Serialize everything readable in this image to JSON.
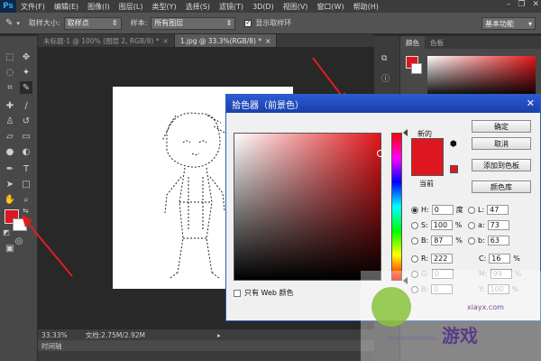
{
  "menubar": {
    "logo": "Ps",
    "items": [
      "文件(F)",
      "编辑(E)",
      "图像(I)",
      "图层(L)",
      "类型(Y)",
      "选择(S)",
      "滤镜(T)",
      "3D(D)",
      "视图(V)",
      "窗口(W)",
      "帮助(H)"
    ]
  },
  "optbar": {
    "sample_size_label": "取样大小:",
    "sample_size_value": "取样点",
    "sample_label": "样本:",
    "sample_value": "所有图层",
    "show_ring_label": "显示取样环",
    "workspace": "基本功能"
  },
  "doctabs": [
    {
      "label": "未标题-1 @ 100% (图层 2, RGB/8) *",
      "close": "×"
    },
    {
      "label": "1.jpg @ 33.3%(RGB/8) *",
      "close": "×"
    }
  ],
  "status": {
    "zoom": "33.33%",
    "doc": "文档:2.75M/2.92M"
  },
  "timeline": {
    "label": "时间轴"
  },
  "rightpanel": {
    "tabs": [
      "颜色",
      "色板"
    ]
  },
  "dialog": {
    "title": "拾色器（前景色）",
    "close": "✕",
    "new_label": "新的",
    "current_label": "当前",
    "buttons": {
      "ok": "确定",
      "cancel": "取消",
      "add_swatch": "添加到色板",
      "color_libraries": "颜色库"
    },
    "fields": {
      "H": {
        "label": "H:",
        "value": "0",
        "unit": "度"
      },
      "S": {
        "label": "S:",
        "value": "100",
        "unit": "%"
      },
      "B": {
        "label": "B:",
        "value": "87",
        "unit": "%"
      },
      "R": {
        "label": "R:",
        "value": "222"
      },
      "G": {
        "label": "G:",
        "value": "0"
      },
      "Bl": {
        "label": "B:",
        "value": "0"
      },
      "L": {
        "label": "L:",
        "value": "47"
      },
      "a": {
        "label": "a:",
        "value": "73"
      },
      "b": {
        "label": "b:",
        "value": "63"
      },
      "C": {
        "label": "C:",
        "value": "16",
        "unit": "%"
      },
      "M": {
        "label": "M:",
        "value": "99",
        "unit": "%"
      },
      "Y": {
        "label": "Y:",
        "value": "100",
        "unit": "%"
      },
      "hex": {
        "label": "#",
        "value": ""
      }
    },
    "web_only": "只有 Web 颜色"
  },
  "colors": {
    "foreground": "#de161f",
    "dialog_title_bar": "#2b5bd6",
    "selected_color": "#de161f"
  },
  "watermark": {
    "text": "游戏",
    "url": "xiayx.com",
    "sub": "ZIHAOYOUXIWANG"
  }
}
